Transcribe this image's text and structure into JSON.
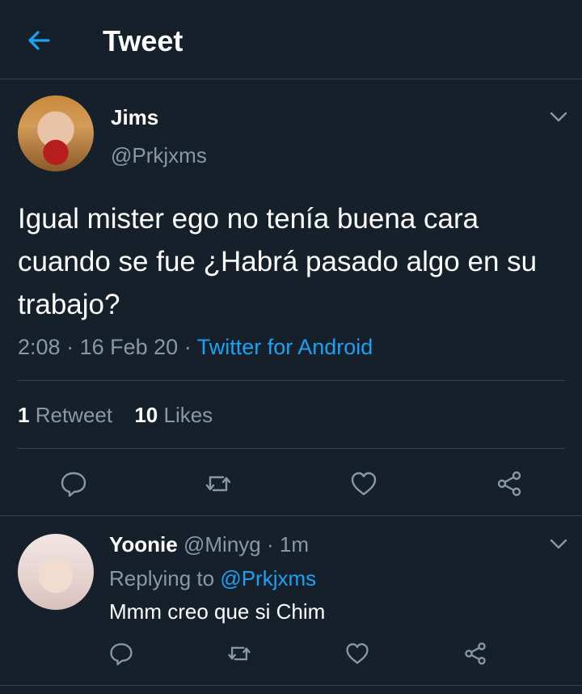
{
  "header": {
    "title": "Tweet"
  },
  "tweet": {
    "author_name": "Jims",
    "author_handle": "@Prkjxms",
    "text": "Igual mister ego no tenía buena cara cuando se fue ¿Habrá pasado algo en su trabajo?",
    "time": "2:08",
    "date": "16 Feb 20",
    "separator": "·",
    "source": "Twitter for Android",
    "retweet_count": "1",
    "retweet_label": "Retweet",
    "like_count": "10",
    "like_label": "Likes"
  },
  "reply": {
    "author_name": "Yoonie",
    "author_handle": "@Minyg",
    "separator": "·",
    "time": "1m",
    "replying_prefix": "Replying to",
    "replying_to": "@Prkjxms",
    "text": "Mmm creo que si Chim"
  },
  "colors": {
    "background": "#15202b",
    "accent": "#1da1f2",
    "muted": "#8899a6",
    "divider": "#38444d"
  }
}
